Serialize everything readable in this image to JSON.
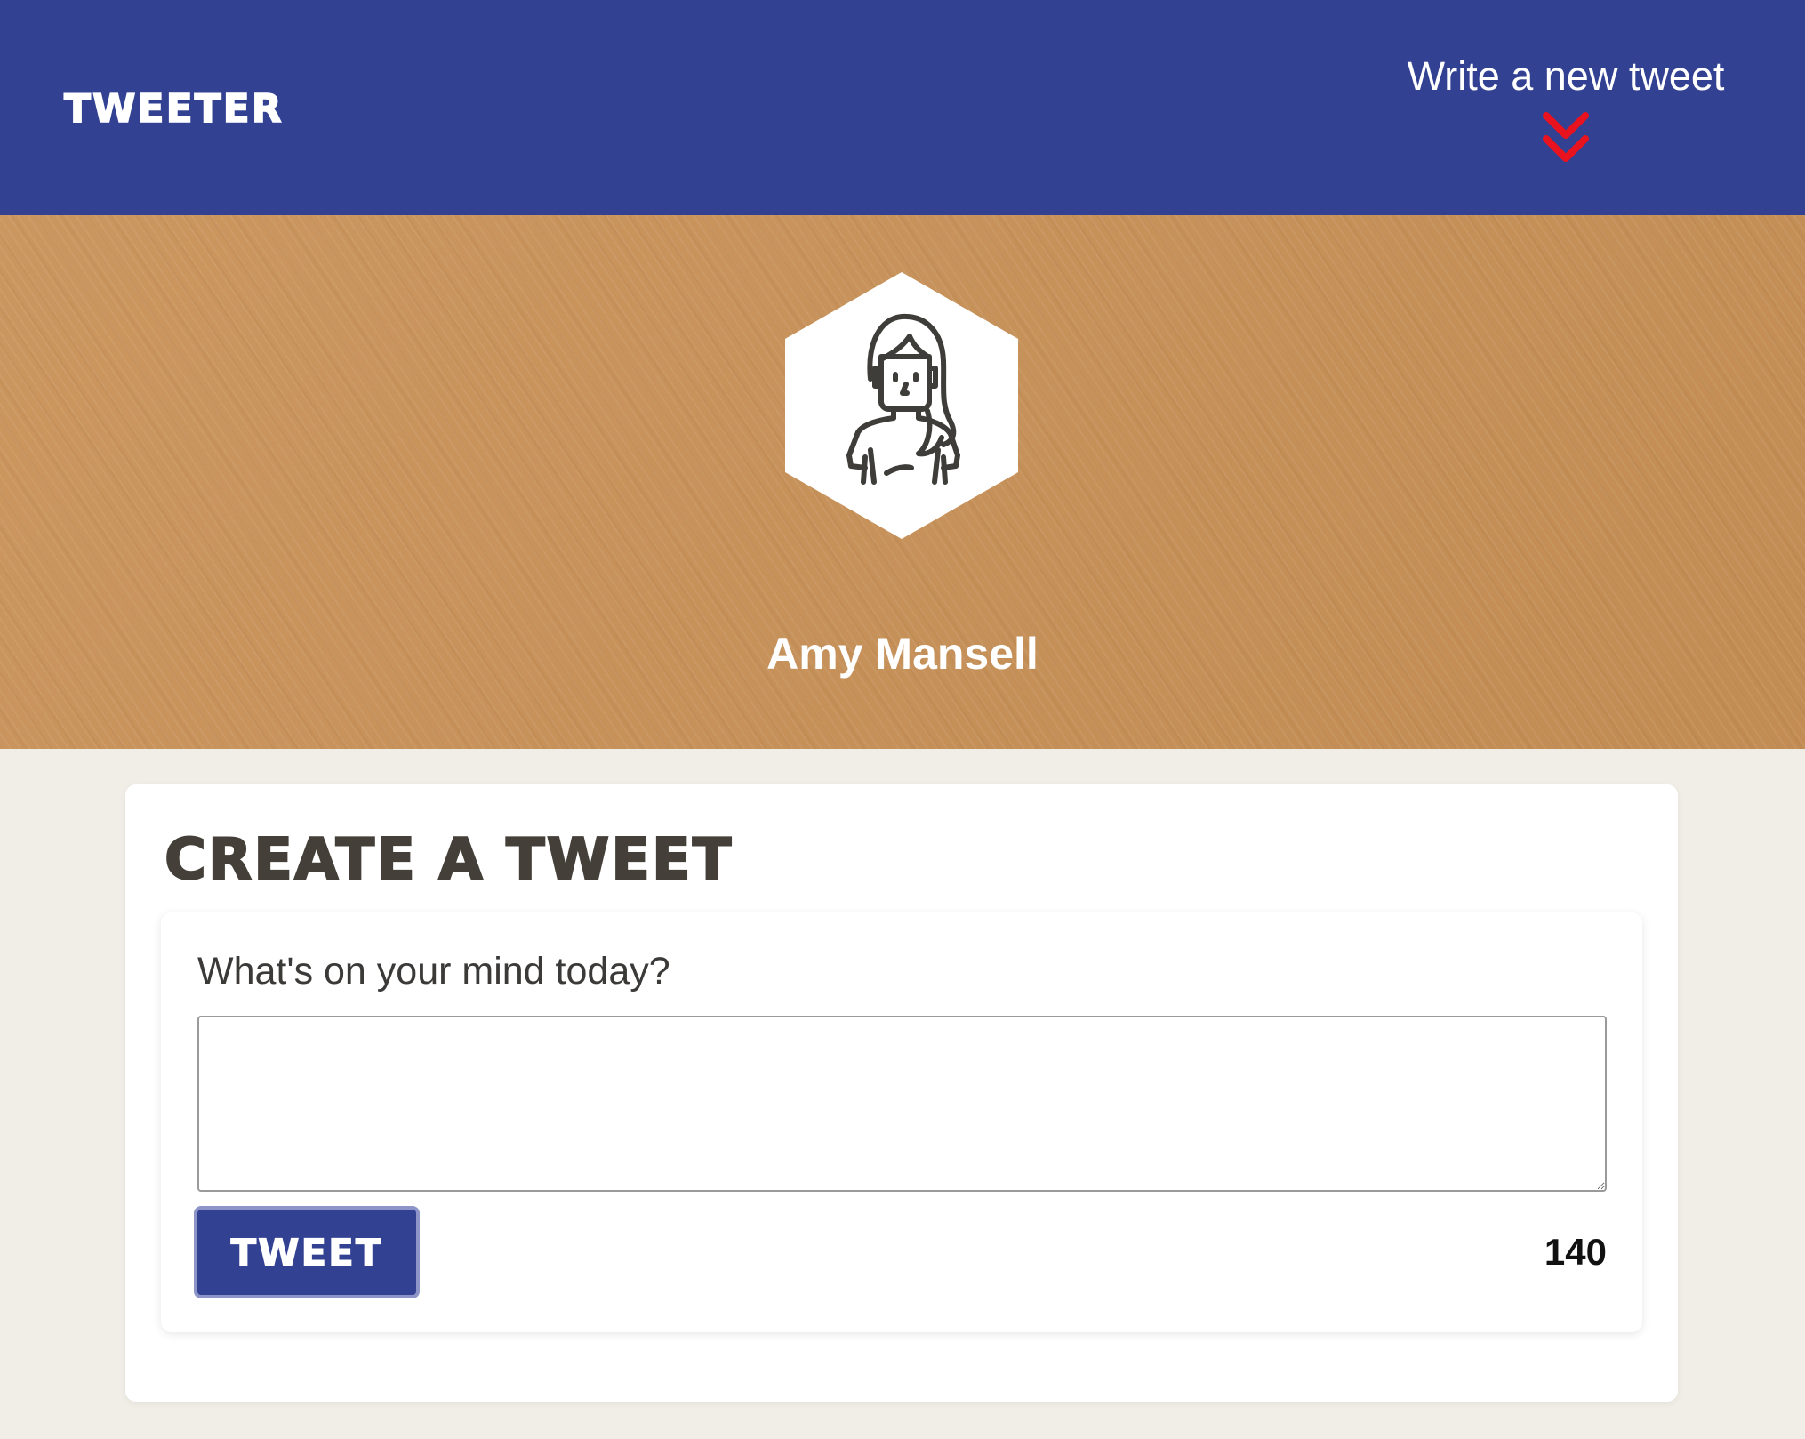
{
  "nav": {
    "brand": "TWEETER",
    "compose_link_label": "Write a new tweet",
    "compose_arrow_icon": "double-chevron-down-icon",
    "colors": {
      "background": "#324192",
      "arrow": "#e8131f"
    }
  },
  "profile": {
    "name": "Amy Mansell",
    "avatar_icon": "user-avatar-icon",
    "header_color": "#c89157"
  },
  "composer": {
    "title": "CREATE A TWEET",
    "prompt": "What's on your mind today?",
    "textarea_value": "",
    "submit_label": "TWEET",
    "char_count": "140"
  }
}
